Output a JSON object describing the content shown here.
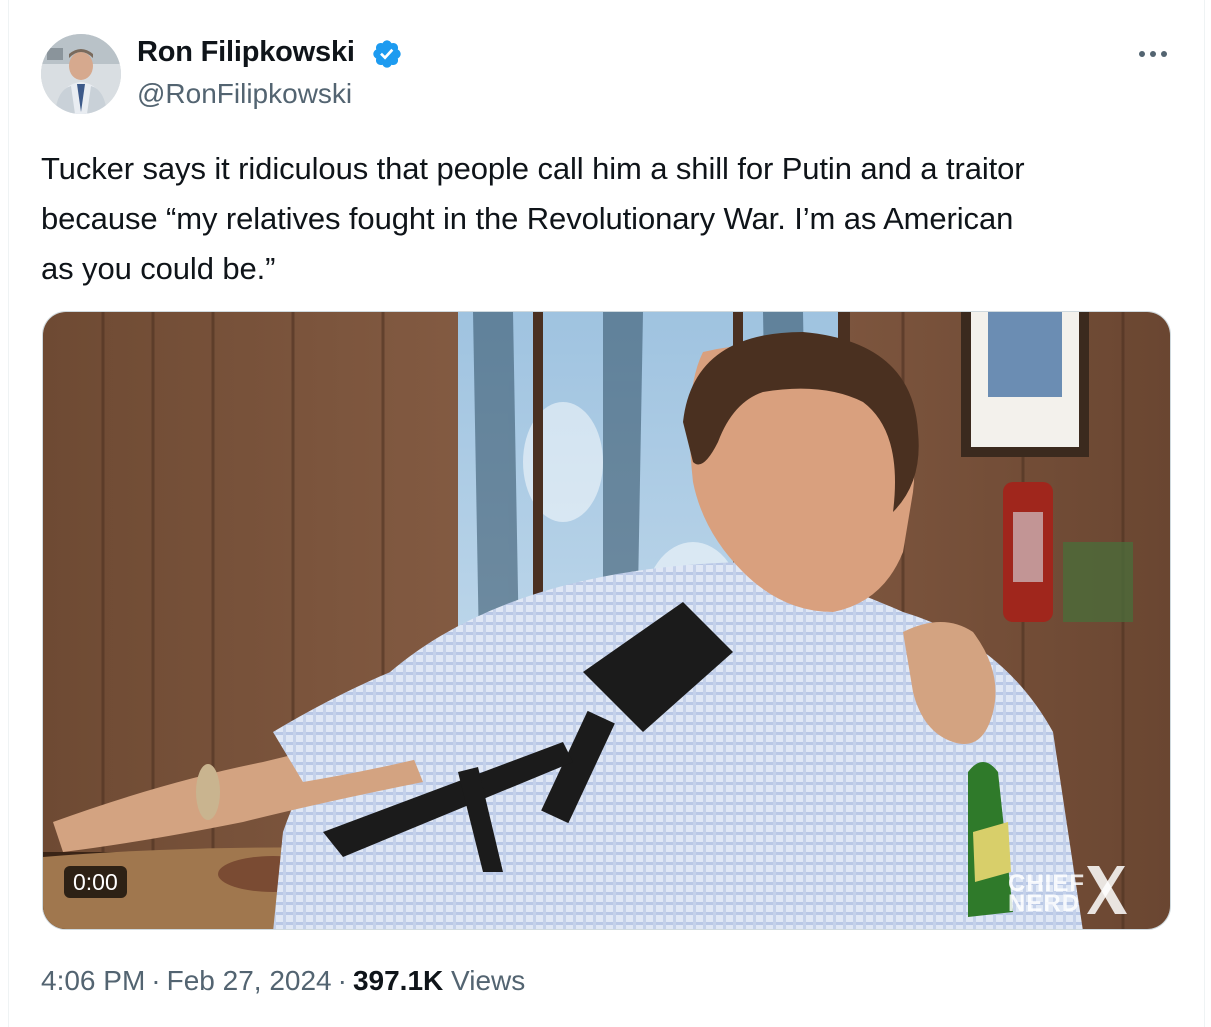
{
  "author": {
    "name": "Ron Filipkowski",
    "handle": "@RonFilipkowski",
    "verified": true
  },
  "icons": {
    "verified": "verified-badge-icon",
    "more": "more-options-icon",
    "watermark": "x-logo-icon"
  },
  "tweet": {
    "text_lines": [
      "Tucker says it ridiculous that people call him a shill for Putin and a traitor",
      "because “my relatives fought in the Revolutionary War. I’m as American",
      "as you could be.”"
    ]
  },
  "media": {
    "timecode": "0:00",
    "watermark_line1": "CHIEF",
    "watermark_line2": "NERD"
  },
  "meta": {
    "time": "4:06 PM",
    "date": "Feb 27, 2024",
    "views_count": "397.1K",
    "views_label": "Views",
    "separator": "·"
  },
  "colors": {
    "text_primary": "#0f1419",
    "text_secondary": "#536471",
    "verified_blue": "#1d9bf0",
    "border": "#cfd9de"
  }
}
